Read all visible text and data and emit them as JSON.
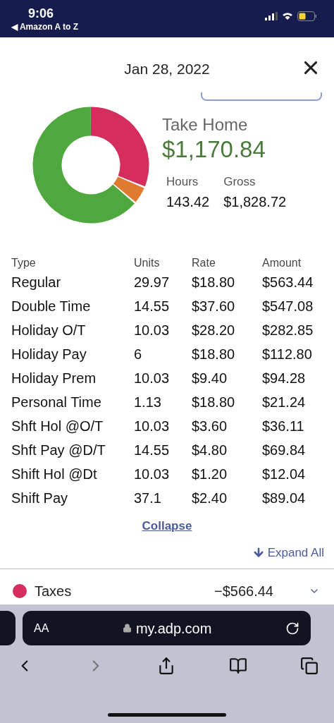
{
  "status_bar": {
    "time": "9:06",
    "back_app": "◀ Amazon A to Z"
  },
  "header": {
    "title": "Jan 28, 2022"
  },
  "summary": {
    "take_home_label": "Take Home",
    "take_home": "$1,170.84",
    "hours_label": "Hours",
    "hours": "143.42",
    "gross_label": "Gross",
    "gross": "$1,828.72"
  },
  "table": {
    "columns": [
      "Type",
      "Units",
      "Rate",
      "Amount"
    ],
    "rows": [
      [
        "Regular",
        "29.97",
        "$18.80",
        "$563.44"
      ],
      [
        "Double Time",
        "14.55",
        "$37.60",
        "$547.08"
      ],
      [
        "Holiday O/T",
        "10.03",
        "$28.20",
        "$282.85"
      ],
      [
        "Holiday Pay",
        "6",
        "$18.80",
        "$112.80"
      ],
      [
        "Holiday Prem",
        "10.03",
        "$9.40",
        "$94.28"
      ],
      [
        "Personal Time",
        "1.13",
        "$18.80",
        "$21.24"
      ],
      [
        "Shft Hol @O/T",
        "10.03",
        "$3.60",
        "$36.11"
      ],
      [
        "Shft Pay @D/T",
        "14.55",
        "$4.80",
        "$69.84"
      ],
      [
        "Shift Hol @Dt",
        "10.03",
        "$1.20",
        "$12.04"
      ],
      [
        "Shift Pay",
        "37.1",
        "$2.40",
        "$89.04"
      ]
    ]
  },
  "collapse_link": "Collapse",
  "expand_all": "Expand All",
  "sections": [
    {
      "label": "Taxes",
      "amount": "−$566.44",
      "color": "#d62d5f",
      "expanded": false
    }
  ],
  "browser": {
    "text_size": "AA",
    "url": "my.adp.com"
  }
}
